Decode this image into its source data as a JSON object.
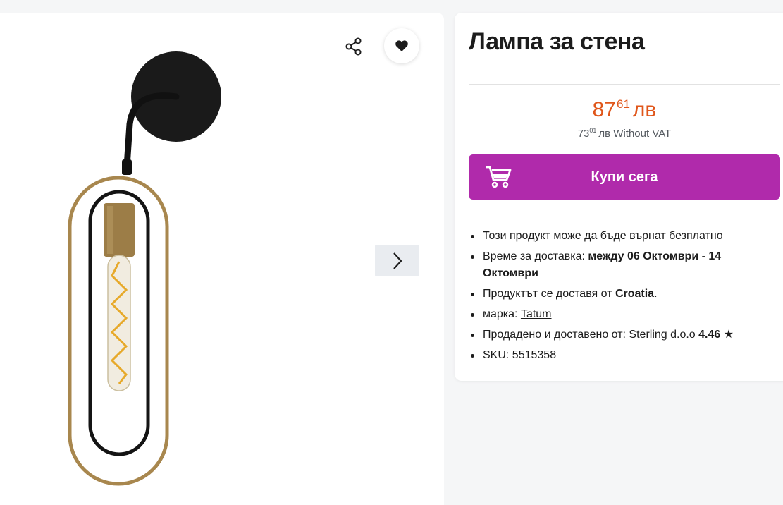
{
  "product": {
    "title": "Лампа за стена",
    "image_alt": "wall lamp with brass oval frame and edison bulb"
  },
  "gallery": {
    "icons": {
      "share": "share-icon",
      "favorite": "heart-icon",
      "next": "chevron-right-icon"
    }
  },
  "price": {
    "main_int": "87",
    "main_dec": "61",
    "currency": "лв",
    "novat_int": "73",
    "novat_dec": "01",
    "novat_suffix": "лв Without VAT"
  },
  "buy": {
    "label": "Купи сега",
    "icon": "cart-icon"
  },
  "details": {
    "returnable": "Този продукт може да бъде върнат безплатно",
    "delivery_label": "Време за доставка: ",
    "delivery_value": "между 06 Октомври - 14 Октомври",
    "origin_label": "Продуктът се доставя от ",
    "origin_value": "Croatia",
    "origin_suffix": ".",
    "brand_label": "марка: ",
    "brand_value": "Tatum",
    "seller_label": "Продадено и доставено от: ",
    "seller_value": "Sterling d.o.o",
    "seller_rating": "4.46",
    "seller_star": "★",
    "sku_label": "SKU: ",
    "sku_value": "5515358"
  },
  "colors": {
    "accent": "#b02aab",
    "price": "#e0561a",
    "background": "#f5f6f7"
  }
}
